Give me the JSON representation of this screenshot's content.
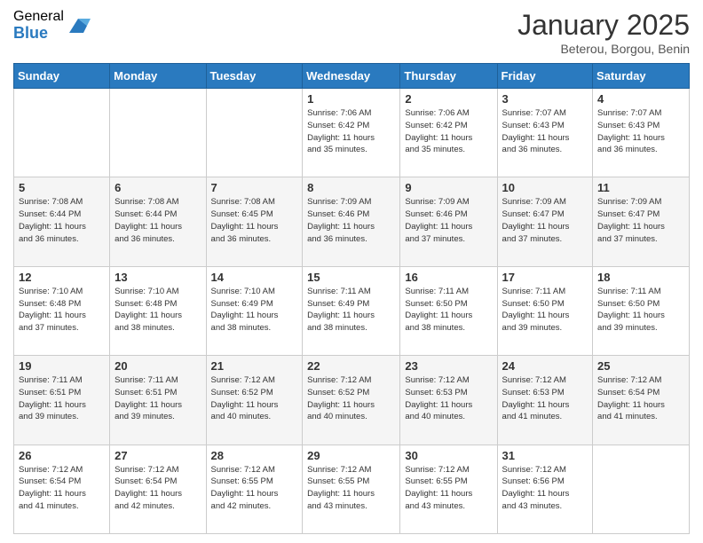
{
  "header": {
    "logo_general": "General",
    "logo_blue": "Blue",
    "month_title": "January 2025",
    "location": "Beterou, Borgou, Benin"
  },
  "weekdays": [
    "Sunday",
    "Monday",
    "Tuesday",
    "Wednesday",
    "Thursday",
    "Friday",
    "Saturday"
  ],
  "weeks": [
    [
      {
        "day": "",
        "info": ""
      },
      {
        "day": "",
        "info": ""
      },
      {
        "day": "",
        "info": ""
      },
      {
        "day": "1",
        "info": "Sunrise: 7:06 AM\nSunset: 6:42 PM\nDaylight: 11 hours\nand 35 minutes."
      },
      {
        "day": "2",
        "info": "Sunrise: 7:06 AM\nSunset: 6:42 PM\nDaylight: 11 hours\nand 35 minutes."
      },
      {
        "day": "3",
        "info": "Sunrise: 7:07 AM\nSunset: 6:43 PM\nDaylight: 11 hours\nand 36 minutes."
      },
      {
        "day": "4",
        "info": "Sunrise: 7:07 AM\nSunset: 6:43 PM\nDaylight: 11 hours\nand 36 minutes."
      }
    ],
    [
      {
        "day": "5",
        "info": "Sunrise: 7:08 AM\nSunset: 6:44 PM\nDaylight: 11 hours\nand 36 minutes."
      },
      {
        "day": "6",
        "info": "Sunrise: 7:08 AM\nSunset: 6:44 PM\nDaylight: 11 hours\nand 36 minutes."
      },
      {
        "day": "7",
        "info": "Sunrise: 7:08 AM\nSunset: 6:45 PM\nDaylight: 11 hours\nand 36 minutes."
      },
      {
        "day": "8",
        "info": "Sunrise: 7:09 AM\nSunset: 6:46 PM\nDaylight: 11 hours\nand 36 minutes."
      },
      {
        "day": "9",
        "info": "Sunrise: 7:09 AM\nSunset: 6:46 PM\nDaylight: 11 hours\nand 37 minutes."
      },
      {
        "day": "10",
        "info": "Sunrise: 7:09 AM\nSunset: 6:47 PM\nDaylight: 11 hours\nand 37 minutes."
      },
      {
        "day": "11",
        "info": "Sunrise: 7:09 AM\nSunset: 6:47 PM\nDaylight: 11 hours\nand 37 minutes."
      }
    ],
    [
      {
        "day": "12",
        "info": "Sunrise: 7:10 AM\nSunset: 6:48 PM\nDaylight: 11 hours\nand 37 minutes."
      },
      {
        "day": "13",
        "info": "Sunrise: 7:10 AM\nSunset: 6:48 PM\nDaylight: 11 hours\nand 38 minutes."
      },
      {
        "day": "14",
        "info": "Sunrise: 7:10 AM\nSunset: 6:49 PM\nDaylight: 11 hours\nand 38 minutes."
      },
      {
        "day": "15",
        "info": "Sunrise: 7:11 AM\nSunset: 6:49 PM\nDaylight: 11 hours\nand 38 minutes."
      },
      {
        "day": "16",
        "info": "Sunrise: 7:11 AM\nSunset: 6:50 PM\nDaylight: 11 hours\nand 38 minutes."
      },
      {
        "day": "17",
        "info": "Sunrise: 7:11 AM\nSunset: 6:50 PM\nDaylight: 11 hours\nand 39 minutes."
      },
      {
        "day": "18",
        "info": "Sunrise: 7:11 AM\nSunset: 6:50 PM\nDaylight: 11 hours\nand 39 minutes."
      }
    ],
    [
      {
        "day": "19",
        "info": "Sunrise: 7:11 AM\nSunset: 6:51 PM\nDaylight: 11 hours\nand 39 minutes."
      },
      {
        "day": "20",
        "info": "Sunrise: 7:11 AM\nSunset: 6:51 PM\nDaylight: 11 hours\nand 39 minutes."
      },
      {
        "day": "21",
        "info": "Sunrise: 7:12 AM\nSunset: 6:52 PM\nDaylight: 11 hours\nand 40 minutes."
      },
      {
        "day": "22",
        "info": "Sunrise: 7:12 AM\nSunset: 6:52 PM\nDaylight: 11 hours\nand 40 minutes."
      },
      {
        "day": "23",
        "info": "Sunrise: 7:12 AM\nSunset: 6:53 PM\nDaylight: 11 hours\nand 40 minutes."
      },
      {
        "day": "24",
        "info": "Sunrise: 7:12 AM\nSunset: 6:53 PM\nDaylight: 11 hours\nand 41 minutes."
      },
      {
        "day": "25",
        "info": "Sunrise: 7:12 AM\nSunset: 6:54 PM\nDaylight: 11 hours\nand 41 minutes."
      }
    ],
    [
      {
        "day": "26",
        "info": "Sunrise: 7:12 AM\nSunset: 6:54 PM\nDaylight: 11 hours\nand 41 minutes."
      },
      {
        "day": "27",
        "info": "Sunrise: 7:12 AM\nSunset: 6:54 PM\nDaylight: 11 hours\nand 42 minutes."
      },
      {
        "day": "28",
        "info": "Sunrise: 7:12 AM\nSunset: 6:55 PM\nDaylight: 11 hours\nand 42 minutes."
      },
      {
        "day": "29",
        "info": "Sunrise: 7:12 AM\nSunset: 6:55 PM\nDaylight: 11 hours\nand 43 minutes."
      },
      {
        "day": "30",
        "info": "Sunrise: 7:12 AM\nSunset: 6:55 PM\nDaylight: 11 hours\nand 43 minutes."
      },
      {
        "day": "31",
        "info": "Sunrise: 7:12 AM\nSunset: 6:56 PM\nDaylight: 11 hours\nand 43 minutes."
      },
      {
        "day": "",
        "info": ""
      }
    ]
  ]
}
